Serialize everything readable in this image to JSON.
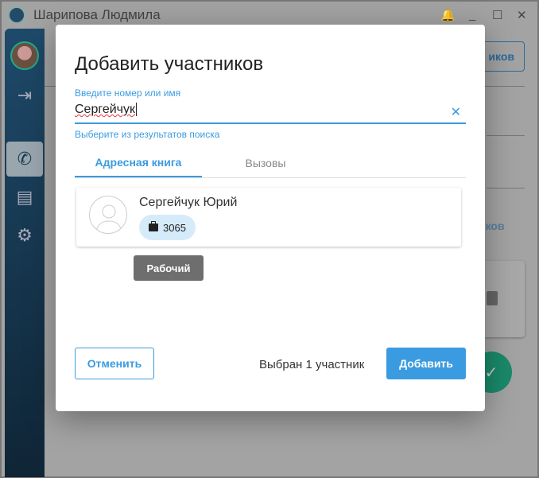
{
  "window": {
    "title": "Шарипова Людмила",
    "controls": [
      "_",
      "☐",
      "✕"
    ]
  },
  "background": {
    "top_button": "иков",
    "link": "иков"
  },
  "dialog": {
    "title": "Добавить участников",
    "field_label": "Введите номер или имя",
    "field_value": "Сергейчук",
    "hint": "Выберите из результатов поиска",
    "tabs": [
      {
        "label": "Адресная книга",
        "active": true
      },
      {
        "label": "Вызовы",
        "active": false
      }
    ],
    "result": {
      "name": "Сергейчук Юрий",
      "number": "3065",
      "tooltip": "Рабочий"
    },
    "cancel": "Отменить",
    "selected": "Выбран 1 участник",
    "add": "Добавить"
  },
  "colors": {
    "accent": "#3b9be0",
    "sidebar": "#1e4a6a"
  }
}
